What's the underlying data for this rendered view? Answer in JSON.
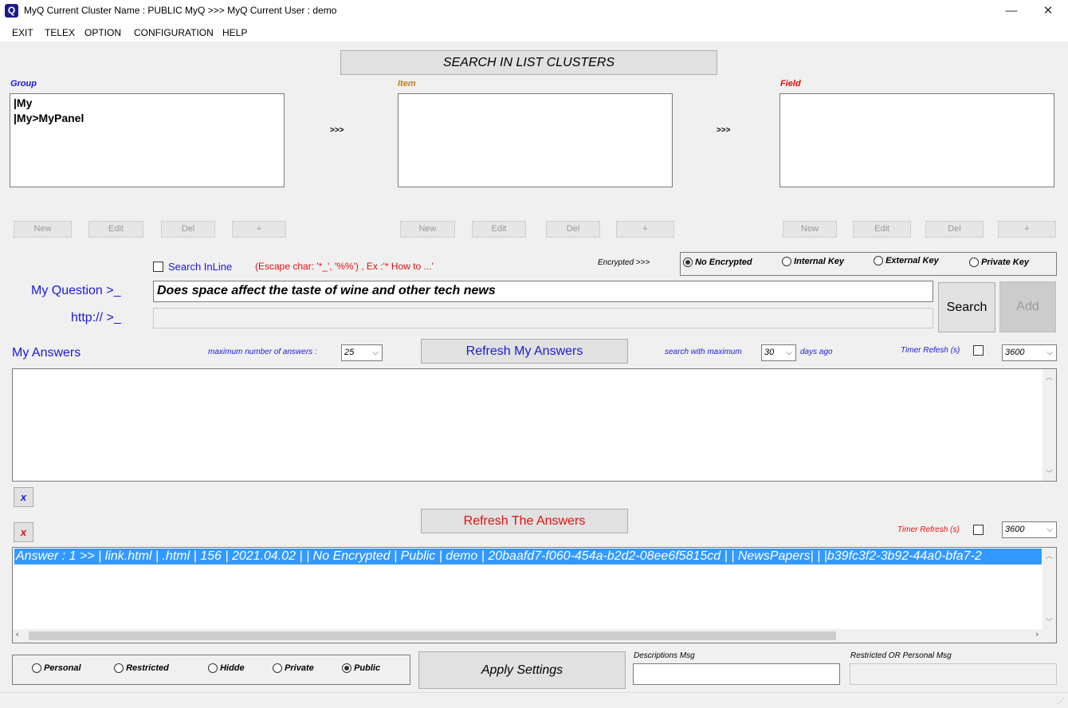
{
  "window": {
    "title": "MyQ Current Cluster Name : PUBLIC MyQ >>> MyQ Current User : demo",
    "minimize": "—",
    "maximize": "☐",
    "close": "✕"
  },
  "menu": [
    "EXIT",
    "TELEX",
    "OPTION",
    "CONFIGURATION",
    "HELP"
  ],
  "search_clusters_button": "SEARCH IN LIST CLUSTERS",
  "group": {
    "label": "Group",
    "items": [
      "|My",
      "|My>MyPanel"
    ],
    "buttons": [
      "New",
      "Edit",
      "Del",
      "+"
    ]
  },
  "item": {
    "label": "Item",
    "items": [],
    "buttons": [
      "New",
      "Edit",
      "Del",
      "+"
    ]
  },
  "field": {
    "label": "Field",
    "items": [],
    "buttons": [
      "New",
      "Edit",
      "Del",
      "+"
    ]
  },
  "arrows": ">>>",
  "search_inline_label": "Search InLine",
  "escape_hint": "(Escape char: '*_', '%%') , Ex :'* How to ...'",
  "encrypted_label": "Encrypted >>>",
  "encryption_options": [
    "No Encrypted",
    "Internal Key",
    "External Key",
    "Private Key"
  ],
  "encryption_selected": "No Encrypted",
  "question_label": "My Question >_",
  "question_value": "Does space affect the taste of wine and other tech news",
  "http_label": "http:// >_",
  "http_value": "",
  "search_button": "Search",
  "add_button": "Add",
  "my_answers": {
    "label": "My Answers",
    "max_label": "maximum number of answers :",
    "max_value": "25",
    "refresh_button": "Refresh My Answers",
    "search_max_label": "search with maximum",
    "days_value": "30",
    "days_label": "days ago",
    "timer_label": "Timer Refesh (s)",
    "timer_value": "3600",
    "clear_button": "x"
  },
  "answers": {
    "refresh_button": "Refresh The Answers",
    "timer_label": "Timer Refresh (s)",
    "timer_value": "3600",
    "clear_button": "x",
    "rows": [
      "Answer : 1 >> | link.html | .html | 156 | 2021.04.02 |  | No Encrypted | Public | demo | 20baafd7-f060-454a-b2d2-08ee6f5815cd |  | NewsPapers|   | |b39fc3f2-3b92-44a0-bfa7-2"
    ]
  },
  "visibility_options": [
    "Personal",
    "Restricted",
    "Hidde",
    "Private",
    "Public"
  ],
  "visibility_selected": "Public",
  "apply_button": "Apply Settings",
  "descriptions_label": "Descriptions Msg",
  "descriptions_value": "",
  "restricted_label": "Restricted OR Personal Msg",
  "restricted_value": "",
  "colors": {
    "accent_blue": "#1a1ad6",
    "accent_red": "#e01010",
    "selection": "#3399ff"
  }
}
